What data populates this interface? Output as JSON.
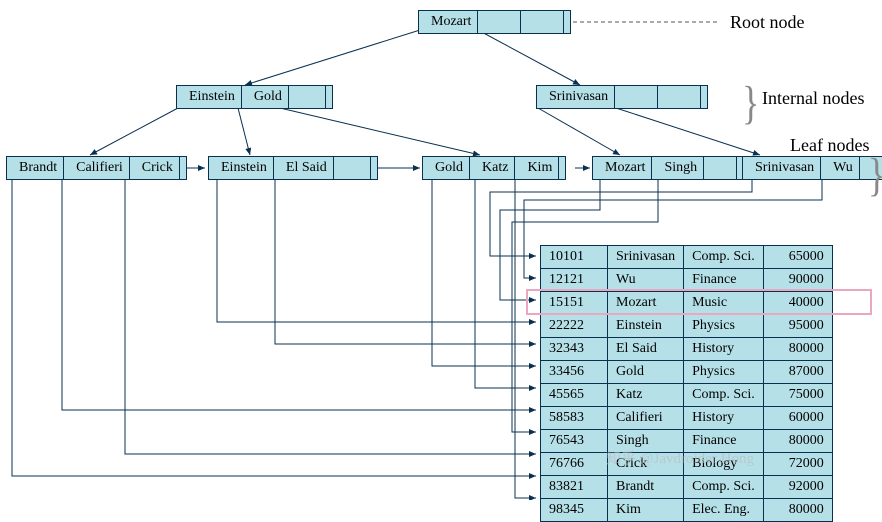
{
  "labels": {
    "root": "Root node",
    "internal": "Internal nodes",
    "leaf": "Leaf nodes"
  },
  "tree": {
    "root": [
      "Mozart"
    ],
    "internal": [
      [
        "Einstein",
        "Gold"
      ],
      [
        "Srinivasan"
      ]
    ],
    "leaves": [
      [
        "Brandt",
        "Califieri",
        "Crick"
      ],
      [
        "Einstein",
        "El Said"
      ],
      [
        "Gold",
        "Katz",
        "Kim"
      ],
      [
        "Mozart",
        "Singh"
      ],
      [
        "Srinivasan",
        "Wu"
      ]
    ]
  },
  "table": [
    [
      "10101",
      "Srinivasan",
      "Comp. Sci.",
      "65000"
    ],
    [
      "12121",
      "Wu",
      "Finance",
      "90000"
    ],
    [
      "15151",
      "Mozart",
      "Music",
      "40000"
    ],
    [
      "22222",
      "Einstein",
      "Physics",
      "95000"
    ],
    [
      "32343",
      "El Said",
      "History",
      "80000"
    ],
    [
      "33456",
      "Gold",
      "Physics",
      "87000"
    ],
    [
      "45565",
      "Katz",
      "Comp. Sci.",
      "75000"
    ],
    [
      "58583",
      "Califieri",
      "History",
      "60000"
    ],
    [
      "76543",
      "Singh",
      "Finance",
      "80000"
    ],
    [
      "76766",
      "Crick",
      "Biology",
      "72000"
    ],
    [
      "83821",
      "Brandt",
      "Comp. Sci.",
      "92000"
    ],
    [
      "98345",
      "Kim",
      "Elec. Eng.",
      "80000"
    ]
  ],
  "highlight_row": 2,
  "watermark": "知乎 @Javdroider Hong"
}
